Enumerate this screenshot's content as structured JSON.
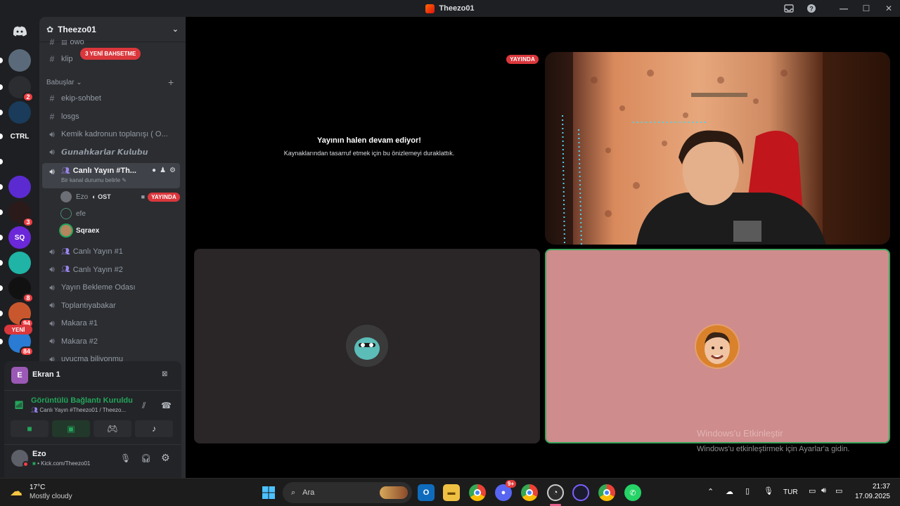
{
  "window": {
    "title": "Theezo01"
  },
  "guild": {
    "name": "Theezo01"
  },
  "servers": [
    {
      "name": "server-avatar-1",
      "color": "#5a6a7a",
      "badge": ""
    },
    {
      "name": "server-dice",
      "color": "#2b2d31",
      "badge": "2"
    },
    {
      "name": "server-sonic",
      "color": "#1a3b5a",
      "badge": ""
    },
    {
      "name": "server-ctrl",
      "label": "CTRL",
      "color": "#1e1f22",
      "badge": ""
    },
    {
      "name": "server-green",
      "color": "#1e1f22",
      "badge": ""
    },
    {
      "name": "server-purple",
      "color": "#5b2bd1",
      "badge": ""
    },
    {
      "name": "server-f",
      "color": "#2b1a1a",
      "badge": "3"
    },
    {
      "name": "server-sq",
      "label": "SQ",
      "color": "#6b28d9",
      "badge": ""
    },
    {
      "name": "server-teal",
      "color": "#1fb4a5",
      "badge": ""
    },
    {
      "name": "server-spider",
      "color": "#111",
      "badge": "8"
    },
    {
      "name": "server-food",
      "color": "#c9572e",
      "badge": "94"
    },
    {
      "name": "server-new",
      "color": "#2a7bd3",
      "badge": "84",
      "label_new": "YENİ"
    }
  ],
  "sidebar": {
    "mention_pill": "3 YENİ BAHSETME",
    "top_channel_partial": "owo",
    "channel_klip": "klip",
    "category": "Babuşlar",
    "channels": [
      {
        "name": "ekip-sohbet",
        "type": "text"
      },
      {
        "name": "losgs",
        "type": "text"
      },
      {
        "name": "Kemik kadronun toplanışı ( O...",
        "type": "voice"
      },
      {
        "name": "𝙂𝙪𝙣𝙖𝙝𝙠𝙖𝙧𝙡𝙖𝙧 𝙆𝙪𝙡𝙪𝙗𝙪",
        "type": "voice"
      }
    ],
    "active_channel": {
      "name": "Canlı Yayın #Th...",
      "status": "Bir kanal durumu belirle"
    },
    "voice_users": [
      {
        "name": "Ezo",
        "tag": "OST",
        "live": "YAYINDA"
      },
      {
        "name": "efe"
      },
      {
        "name": "Sqraex"
      }
    ],
    "more_channels": [
      "Canlı Yayın #1",
      "Canlı Yayın #2",
      "Yayın Bekleme Odası",
      "Toplantıyabakar",
      "Makara #1",
      "Makara #2",
      "uyucma biliyonmu"
    ]
  },
  "screen_share": {
    "initial": "E",
    "label": "Ekran 1"
  },
  "rtc": {
    "status": "Görüntülü Bağlantı Kuruldu",
    "channel": "Canlı Yayın #Theezo01 / Theezo..."
  },
  "user": {
    "name": "Ezo",
    "status": "• Kick.com/Theezo01"
  },
  "stage": {
    "live_badge": "YAYINDA",
    "paused_title": "Yayının halen devam ediyor!",
    "paused_sub": "Kaynaklarından tasarruf etmek için bu önizlemeyi duraklattık.",
    "activation_title": "Windows'u Etkinleştir",
    "activation_sub": "Windows'u etkinleştirmek için Ayarlar'a gidin."
  },
  "taskbar": {
    "weather_temp": "17°C",
    "weather_desc": "Mostly cloudy",
    "search_placeholder": "Ara",
    "lang": "TUR",
    "time": "21:37",
    "date": "17.09.2025",
    "discord_badge": "9+"
  },
  "colors": {
    "live_red": "#da373c",
    "connected_green": "#23a55a",
    "tile_pink": "#cf8c8c",
    "tile_dark": "#2a2526",
    "active_border": "#3ba55d"
  }
}
